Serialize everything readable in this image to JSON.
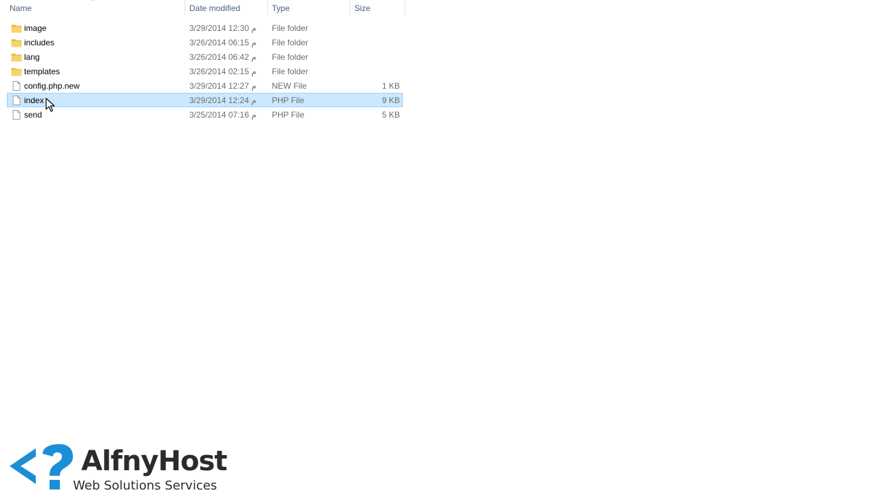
{
  "columns": {
    "name": "Name",
    "date_modified": "Date modified",
    "type": "Type",
    "size": "Size"
  },
  "files": [
    {
      "name": "image",
      "date": "3/29/2014 12:30 م",
      "type": "File folder",
      "size": "",
      "icon": "folder-icon"
    },
    {
      "name": "includes",
      "date": "3/26/2014 06:15 م",
      "type": "File folder",
      "size": "",
      "icon": "folder-icon"
    },
    {
      "name": "lang",
      "date": "3/26/2014 06:42 م",
      "type": "File folder",
      "size": "",
      "icon": "folder-icon"
    },
    {
      "name": "templates",
      "date": "3/26/2014 02:15 م",
      "type": "File folder",
      "size": "",
      "icon": "folder-icon"
    },
    {
      "name": "config.php.new",
      "date": "3/29/2014 12:27 م",
      "type": "NEW File",
      "size": "1 KB",
      "icon": "file-icon"
    },
    {
      "name": "index",
      "date": "3/29/2014 12:24 م",
      "type": "PHP File",
      "size": "9 KB",
      "icon": "file-icon",
      "selected": true
    },
    {
      "name": "send",
      "date": "3/25/2014 07:16 م",
      "type": "PHP File",
      "size": "5 KB",
      "icon": "file-icon"
    }
  ],
  "watermark": {
    "title": "AlfnyHost",
    "subtitle": "Web Solutions Services"
  },
  "colors": {
    "selection_bg": "#cce8ff",
    "selection_border": "#99d1ff",
    "folder": "#f2c94c",
    "logo_blue": "#1b8fd6"
  }
}
